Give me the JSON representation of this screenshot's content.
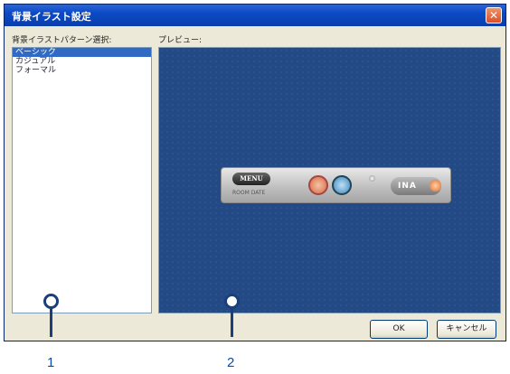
{
  "window": {
    "title": "背景イラスト設定",
    "close_icon": "close-icon"
  },
  "pattern_list": {
    "label": "背景イラストパターン選択:",
    "items": [
      "ベーシック",
      "カジュアル",
      "フォーマル"
    ],
    "selected_index": 0
  },
  "preview": {
    "label": "プレビュー:",
    "widget": {
      "menu_label": "MENU",
      "small_label": "ROOM DATE",
      "logo_text": "INA"
    }
  },
  "buttons": {
    "ok": "OK",
    "cancel": "キャンセル"
  },
  "callouts": {
    "one": "1",
    "two": "2"
  },
  "colors": {
    "titlebar": "#0b49c4",
    "preview_bg": "#234a84",
    "selection": "#316ac5",
    "callout": "#1a3f7a"
  }
}
